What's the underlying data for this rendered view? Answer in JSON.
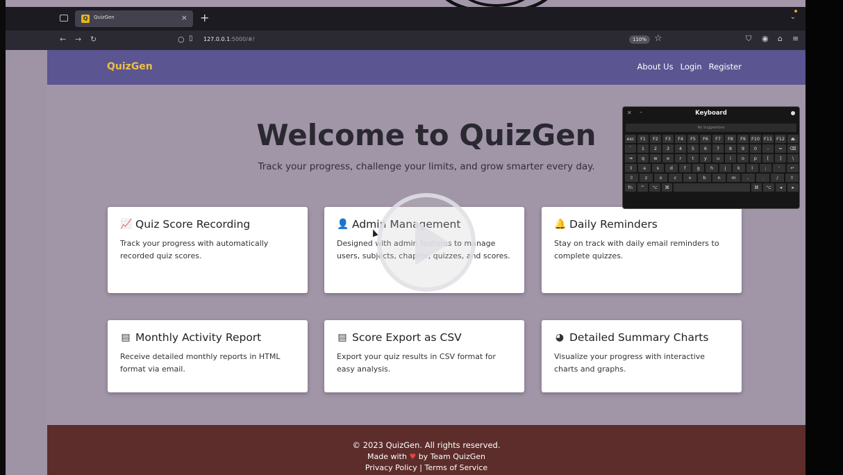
{
  "browser": {
    "tab_title": "QuizGen",
    "tab_favicon": "Q",
    "url_host": "127.0.0.1",
    "url_rest": ":5000/#/",
    "zoom": "110%"
  },
  "site": {
    "brand": "QuizGen",
    "nav": [
      "About Us",
      "Login",
      "Register"
    ],
    "hero_title": "Welcome to QuizGen",
    "hero_subtitle": "Track your progress, challenge your limits, and grow smarter every day.",
    "cards": [
      {
        "icon": "chart-line-icon",
        "glyph": "📈",
        "title": "Quiz Score Recording",
        "text": "Track your progress with automatically recorded quiz scores."
      },
      {
        "icon": "user-gear-icon",
        "glyph": "👤",
        "title": "Admin Management",
        "text": "Designed with admin features to manage users, subjects, chapter, quizzes, and scores."
      },
      {
        "icon": "bell-icon",
        "glyph": "🔔",
        "title": "Daily Reminders",
        "text": "Stay on track with daily email reminders to complete quizzes."
      },
      {
        "icon": "file-icon",
        "glyph": "📄",
        "title": "Monthly Activity Report",
        "text": "Receive detailed monthly reports in HTML format via email."
      },
      {
        "icon": "file-csv-icon",
        "glyph": "📄",
        "title": "Score Export as CSV",
        "text": "Export your quiz results in CSV format for easy analysis."
      },
      {
        "icon": "chart-pie-icon",
        "glyph": "◕",
        "title": "Detailed Summary Charts",
        "text": "Visualize your progress with interactive charts and graphs."
      }
    ],
    "footer": {
      "copyright": "© 2023 QuizGen. All rights reserved.",
      "made_prefix": "Made with",
      "made_suffix": "by Team QuizGen",
      "links": "Privacy Policy | Terms of Service"
    }
  },
  "keyboard": {
    "title": "Keyboard",
    "suggestions": "No Suggestions",
    "rows": [
      [
        "esc",
        "F1",
        "F2",
        "F3",
        "F4",
        "F5",
        "F6",
        "F7",
        "F8",
        "F9",
        "F10",
        "F11",
        "F12",
        "⏏"
      ],
      [
        "`",
        "1",
        "2",
        "3",
        "4",
        "5",
        "6",
        "7",
        "8",
        "9",
        "0",
        "-",
        "=",
        "⌫"
      ],
      [
        "⇥",
        "q",
        "w",
        "e",
        "r",
        "t",
        "y",
        "u",
        "i",
        "o",
        "p",
        "[",
        "]",
        "\\"
      ],
      [
        "⇪",
        "a",
        "s",
        "d",
        "f",
        "g",
        "h",
        "j",
        "k",
        "l",
        ";",
        "'",
        "↵"
      ],
      [
        "⇧",
        "z",
        "x",
        "c",
        "v",
        "b",
        "n",
        "m",
        ",",
        ".",
        "/",
        "⇧"
      ],
      [
        "fn",
        "^",
        "⌥",
        "⌘",
        "",
        "⌘",
        "⌥",
        "◂",
        "▸"
      ]
    ]
  },
  "colors": {
    "header": "#5b5591",
    "main": "#a195a8",
    "footer": "#5c2d2a",
    "brand": "#e8c04a"
  }
}
